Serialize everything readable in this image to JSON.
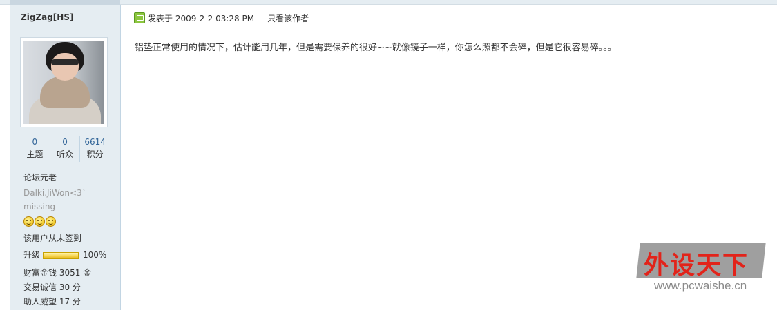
{
  "sidebar": {
    "author_name": "ZigZag[HS]",
    "stats": [
      {
        "value": "0",
        "label": "主题"
      },
      {
        "value": "0",
        "label": "听众"
      },
      {
        "value": "6614",
        "label": "积分"
      }
    ],
    "rank": "论坛元老",
    "custom_title": "Dalki.JiWon<3`",
    "custom_title_2": "missing",
    "smiley_count": 3,
    "checkin_status": "该用户从未签到",
    "level_label": "升级",
    "level_progress_percent": 100,
    "level_progress_text": "100%",
    "money": "财富金钱 3051 金",
    "trust": "交易诚信 30 分",
    "prestige": "助人威望 17 分"
  },
  "post": {
    "posted_at": "发表于 2009-2-2 03:28 PM",
    "only_author_link": "只看该作者",
    "content": "铝垫正常使用的情况下，估计能用几年，但是需要保养的很好~~就像镜子一样，你怎么照都不会碎，但是它很容易碎。。。"
  },
  "watermark": {
    "title": "外设天下",
    "url": "www.pcwaishe.cn"
  },
  "colors": {
    "sidebar_bg": "#e5edf2",
    "stat_number": "#336699",
    "watermark_red": "#e2231a"
  },
  "icons": {
    "online_status": "online-status-icon",
    "smiley": "smiley-icon"
  }
}
